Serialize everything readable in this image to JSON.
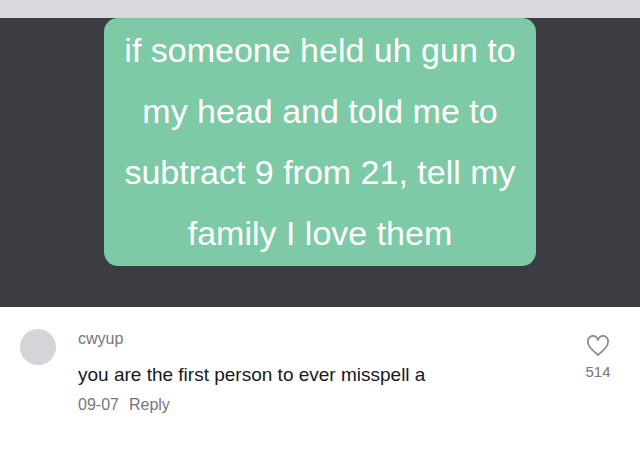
{
  "caption": {
    "lines": [
      "if someone held uh gun to",
      "my head and told me to",
      "subtract 9 from 21, tell my",
      "family I love them"
    ]
  },
  "comment": {
    "username": "cwyup",
    "text": "you are the first person to ever misspell a",
    "date": "09-07",
    "reply": "Reply",
    "likes": "514"
  }
}
